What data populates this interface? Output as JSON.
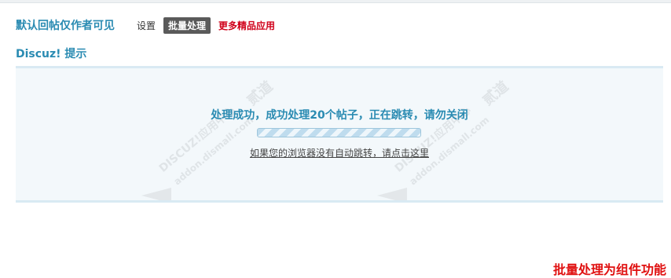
{
  "header": {
    "plugin_title": "默认回帖仅作者可见",
    "nav": {
      "settings": "设置",
      "batch": "批量处理",
      "more": "更多精品应用"
    }
  },
  "notice": {
    "title": "Discuz! 提示",
    "message": "处理成功，成功处理20个帖子，正在跳转，请勿关闭",
    "redirect_link": "如果您的浏览器没有自动跳转，请点击这里"
  },
  "watermark": {
    "brand": "DISCUZ!应用中心",
    "site": "addon.dismall.com",
    "mark": "贰道"
  },
  "footer_note": "批量处理为组件功能"
}
